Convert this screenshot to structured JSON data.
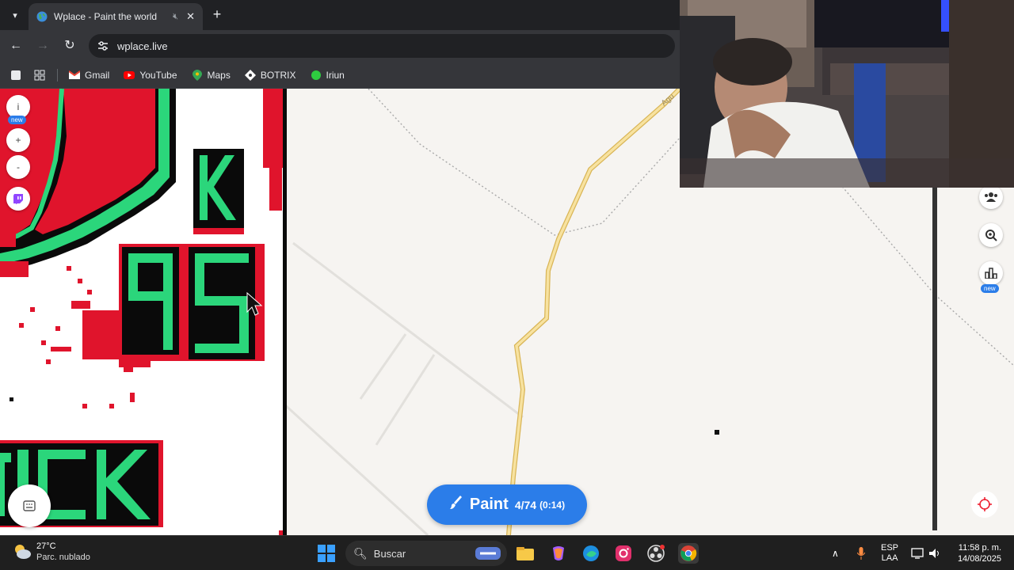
{
  "browser": {
    "tab": {
      "title": "Wplace - Paint the world"
    },
    "url": "wplace.live",
    "bookmarks": [
      {
        "label": "Gmail",
        "icon": "gmail-icon"
      },
      {
        "label": "YouTube",
        "icon": "youtube-icon"
      },
      {
        "label": "Maps",
        "icon": "maps-icon"
      },
      {
        "label": "BOTRIX",
        "icon": "botrix-icon"
      },
      {
        "label": "Iriun",
        "icon": "iriun-icon"
      }
    ]
  },
  "map": {
    "left_controls": [
      {
        "icon": "info-icon",
        "symbol": "i",
        "badge": "new"
      },
      {
        "icon": "zoom-in-icon",
        "symbol": "+"
      },
      {
        "icon": "zoom-out-icon",
        "symbol": "-"
      },
      {
        "icon": "twitch-icon",
        "symbol": "t"
      }
    ],
    "right_controls": [
      {
        "icon": "community-icon"
      },
      {
        "icon": "search-map-icon"
      },
      {
        "icon": "leaderboard-icon",
        "badge": "new"
      }
    ],
    "road_label": "Agu",
    "pixel_art_text": [
      "K",
      "95",
      "ICK"
    ]
  },
  "paint_button": {
    "label": "Paint",
    "count": "4/74",
    "timer": "(0:14)"
  },
  "taskbar": {
    "weather": {
      "temp": "27°C",
      "condition": "Parc. nublado"
    },
    "search_placeholder": "Buscar",
    "language": {
      "line1": "ESP",
      "line2": "LAA"
    },
    "clock": {
      "time": "11:58 p. m.",
      "date": "14/08/2025"
    }
  },
  "colors": {
    "paint_blue": "#2b7de9",
    "pixel_red": "#e0142c",
    "pixel_green": "#2bd67b",
    "road_yellow": "#f2d27a"
  }
}
